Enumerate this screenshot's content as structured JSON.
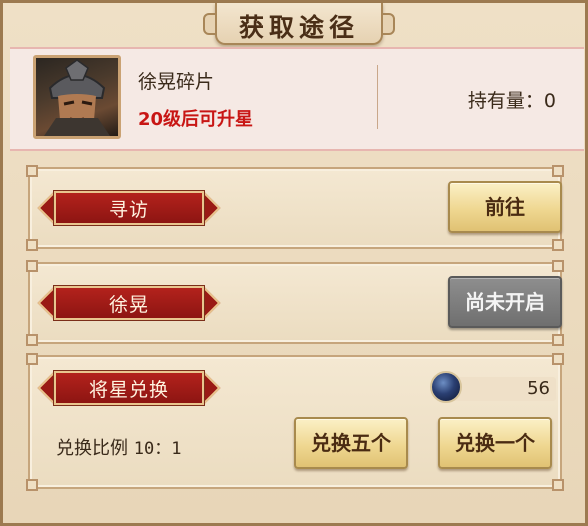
{
  "window": {
    "title": "获取途径"
  },
  "item": {
    "name": "徐晃碎片",
    "star_hint": "20级后可升星",
    "owned_label": "持有量：0"
  },
  "routes": [
    {
      "label": "寻访",
      "button": "前往",
      "enabled": true
    },
    {
      "label": "徐晃",
      "button": "尚未开启",
      "enabled": false
    }
  ],
  "exchange": {
    "label": "将星兑换",
    "currency_icon": "blue-orb-icon",
    "currency_count": "56",
    "ratio_text": "兑换比例",
    "ratio_value": "10：1",
    "buttons": {
      "five": "兑换五个",
      "one": "兑换一个"
    }
  },
  "colors": {
    "banner_red": "#a01c18",
    "hint_red": "#c81614",
    "button_gold": "#efd791",
    "disabled_gray": "#7a7a7a"
  }
}
